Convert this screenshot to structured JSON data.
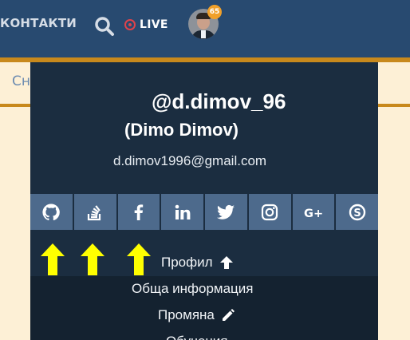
{
  "nav": {
    "contacts": "КОНТАКТИ",
    "live": "LIVE",
    "notification_count": "65"
  },
  "subnav": {
    "partial_label": "Сн"
  },
  "profile": {
    "handle": "@d.dimov_96",
    "full_name": "(Dimo Dimov)",
    "email": "d.dimov1996@gmail.com"
  },
  "social_icons": [
    "github-icon",
    "stackoverflow-icon",
    "facebook-icon",
    "linkedin-icon",
    "twitter-icon",
    "instagram-icon",
    "google-plus-icon",
    "skype-icon"
  ],
  "menu": {
    "profile": "Профил",
    "general_info": "Обща информация",
    "change": "Промяна",
    "partial": "Обучения"
  },
  "colors": {
    "nav_bg": "#284a70",
    "accent_border": "#c8891c",
    "dropdown_bg": "#1b2d40",
    "social_bg": "#4d6a8c",
    "highlight_arrow": "#ffff00"
  }
}
